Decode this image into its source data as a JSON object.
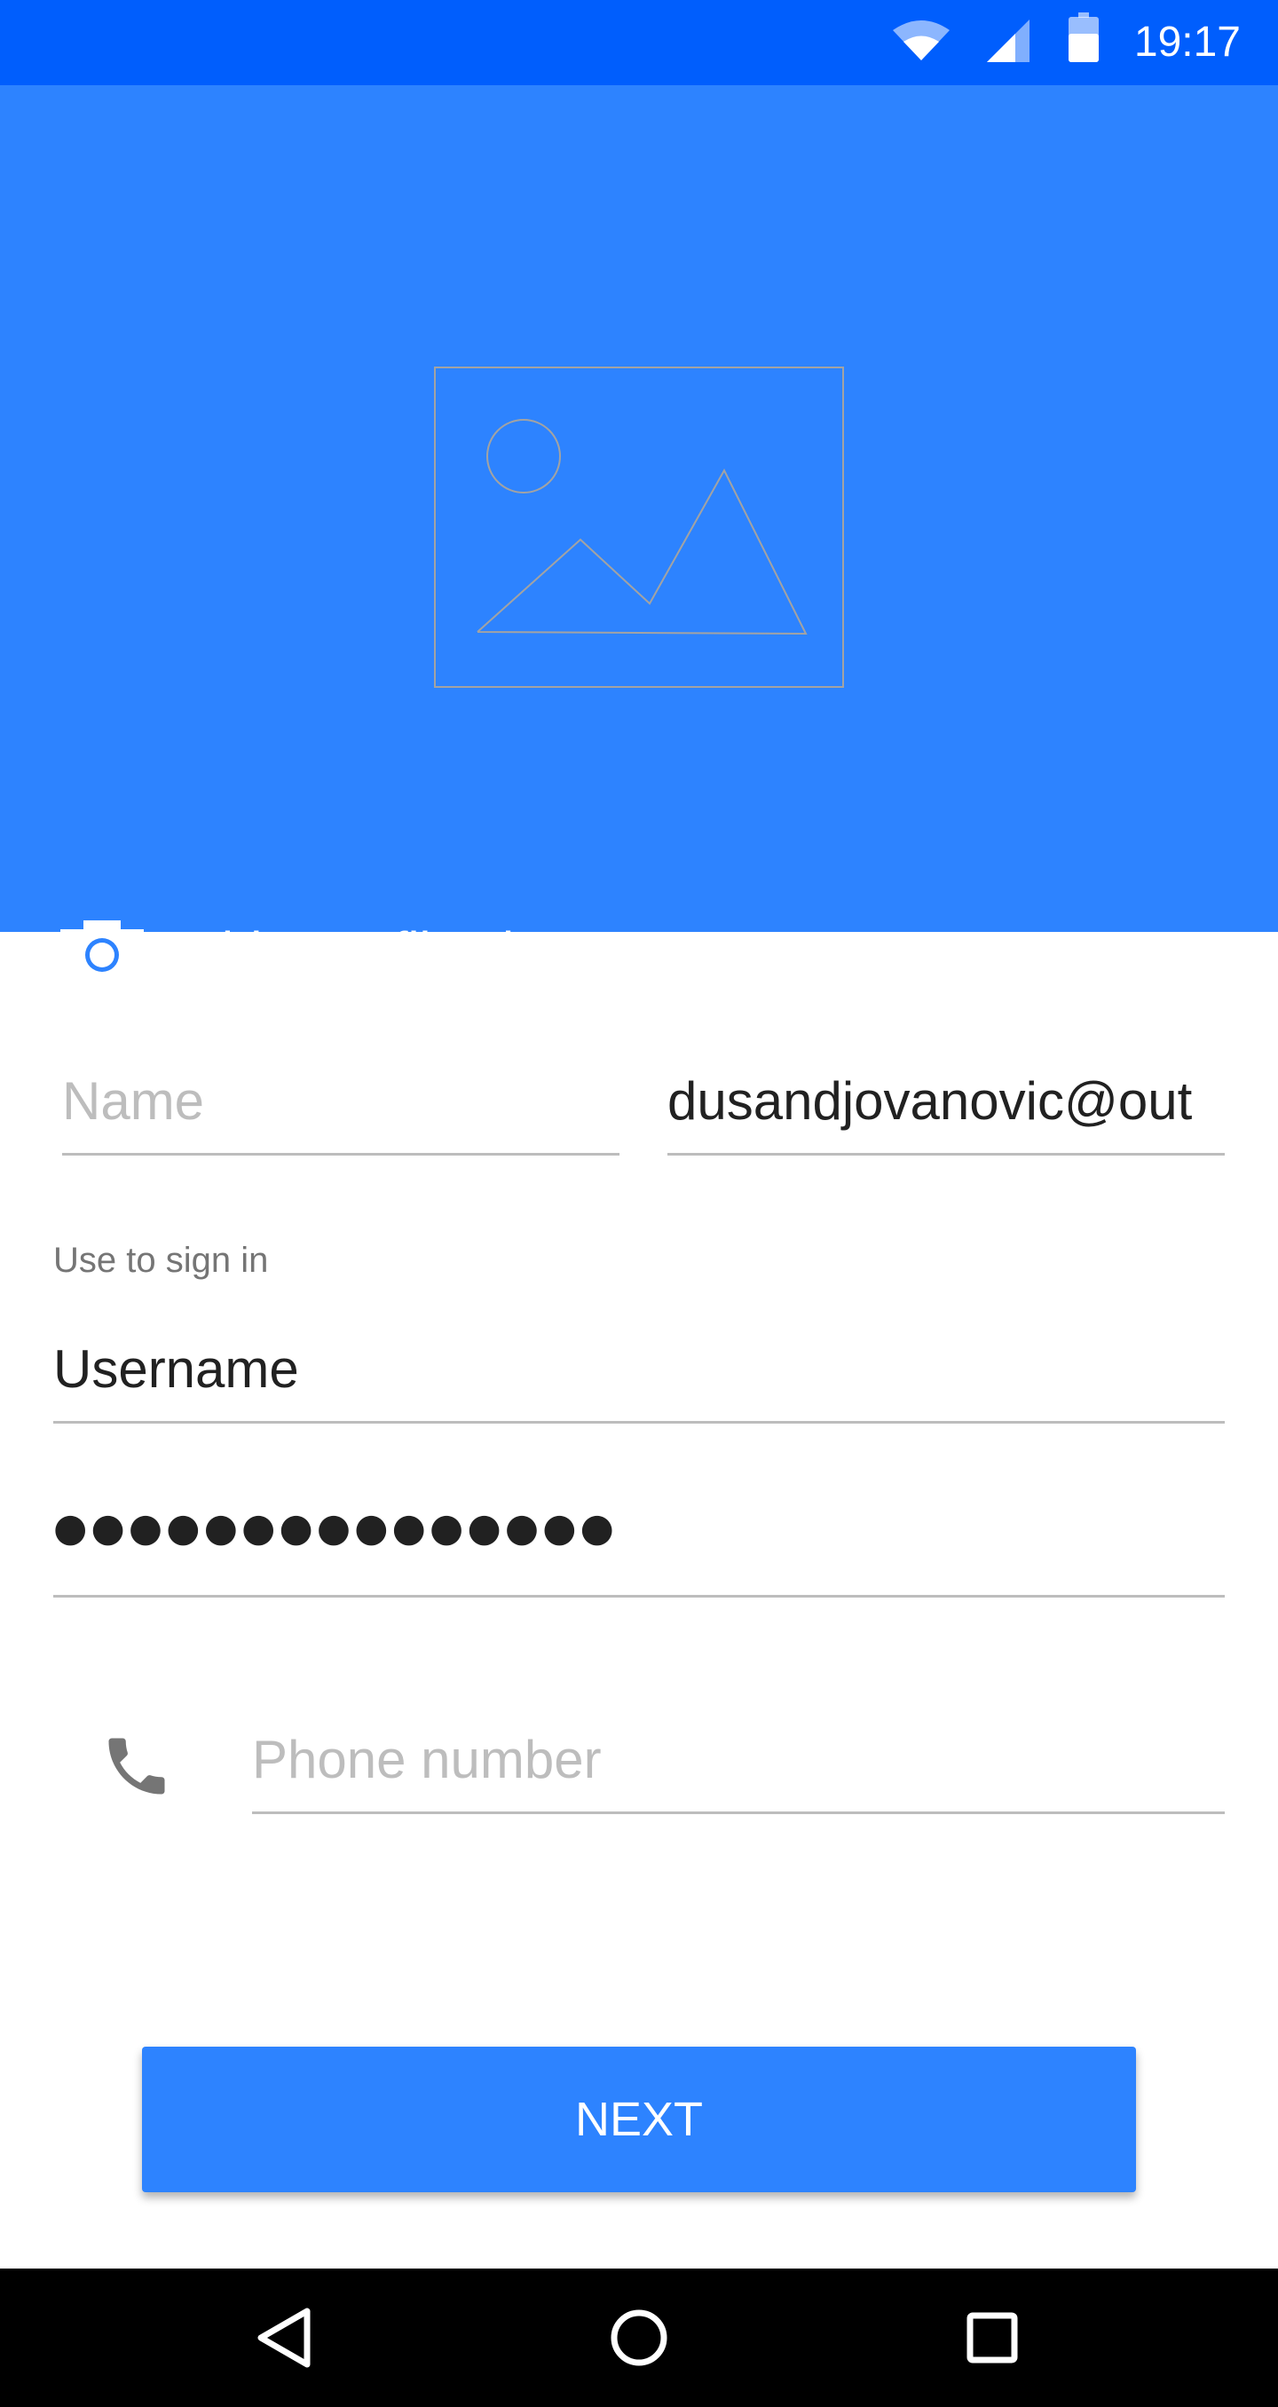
{
  "status_bar": {
    "time": "19:17",
    "icons": [
      "wifi-icon",
      "signal-icon",
      "battery-icon"
    ]
  },
  "header": {
    "placeholder_icon": "image-placeholder-icon",
    "add_photo_label": "Add a profile photo",
    "camera_icon": "camera-icon"
  },
  "form": {
    "name": {
      "placeholder": "Name",
      "value": ""
    },
    "email": {
      "value": "dusandjovanovic@out"
    },
    "helper": "Use to sign in",
    "username": {
      "value": "Username"
    },
    "password": {
      "masked": "●●●●●●●●●●●●●●●"
    },
    "phone": {
      "placeholder": "Phone number",
      "icon": "phone-icon"
    }
  },
  "actions": {
    "next_label": "NEXT"
  },
  "nav_bar": {
    "icons": [
      "back-icon",
      "home-icon",
      "recents-icon"
    ]
  },
  "colors": {
    "status_bar": "#005efd",
    "primary": "#2d83ff",
    "divider": "#bdbdbd",
    "hint": "#bdbdbd",
    "text": "#212121"
  }
}
